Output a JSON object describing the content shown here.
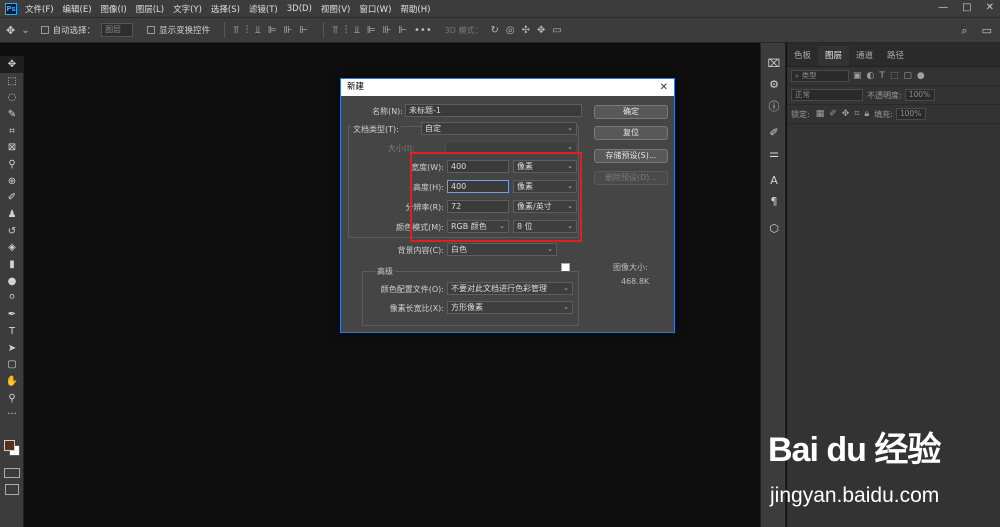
{
  "menubar": {
    "logo": "Ps",
    "items": [
      "文件(F)",
      "编辑(E)",
      "图像(I)",
      "图层(L)",
      "文字(Y)",
      "选择(S)",
      "滤镜(T)",
      "3D(D)",
      "视图(V)",
      "窗口(W)",
      "帮助(H)"
    ],
    "window_controls": [
      "—",
      "□",
      "✕"
    ]
  },
  "options": {
    "auto_select_label": "自动选择：",
    "auto_select_value": "图层",
    "show_transform_label": "显示变换控件",
    "mode_3d": "3D 模式："
  },
  "dialog": {
    "title": "新建",
    "name_label": "名称(N):",
    "name_value": "未标题-1",
    "doc_type_label": "文档类型(T):",
    "doc_type_value": "自定",
    "size_label": "大小(I):",
    "width_label": "宽度(W):",
    "width_value": "400",
    "width_unit": "像素",
    "height_label": "高度(H):",
    "height_value": "400",
    "height_unit": "像素",
    "resolution_label": "分辨率(R):",
    "resolution_value": "72",
    "resolution_unit": "像素/英寸",
    "color_mode_label": "颜色模式(M):",
    "color_mode_value": "RGB 颜色",
    "bit_depth_value": "8 位",
    "bg_label": "背景内容(C):",
    "bg_value": "白色",
    "advanced_title": "高级",
    "color_profile_label": "颜色配置文件(O):",
    "color_profile_value": "不要对此文档进行色彩管理",
    "pixel_aspect_label": "像素长宽比(X):",
    "pixel_aspect_value": "方形像素",
    "buttons": {
      "ok": "确定",
      "reset": "复位",
      "save_preset": "存储预设(S)...",
      "delete_preset": "删除预设(D)..."
    },
    "image_size_label": "图像大小:",
    "image_size_value": "468.8K"
  },
  "panel": {
    "tabs": [
      "色板",
      "图层",
      "通道",
      "路径"
    ],
    "active_tab": 1,
    "filter_kind": "类型",
    "blend_mode": "正常",
    "opacity_label": "不透明度:",
    "opacity_value": "100%",
    "lock_label": "锁定:",
    "fill_label": "填充:",
    "fill_value": "100%"
  },
  "watermark": {
    "logo": "Bai du 经验",
    "url": "jingyan.baidu.com"
  },
  "colors": {
    "accent": "#2f7ad8",
    "highlight": "#e02020",
    "foreground_swatch": "#5a2f1a",
    "background_swatch": "#ffffff"
  }
}
